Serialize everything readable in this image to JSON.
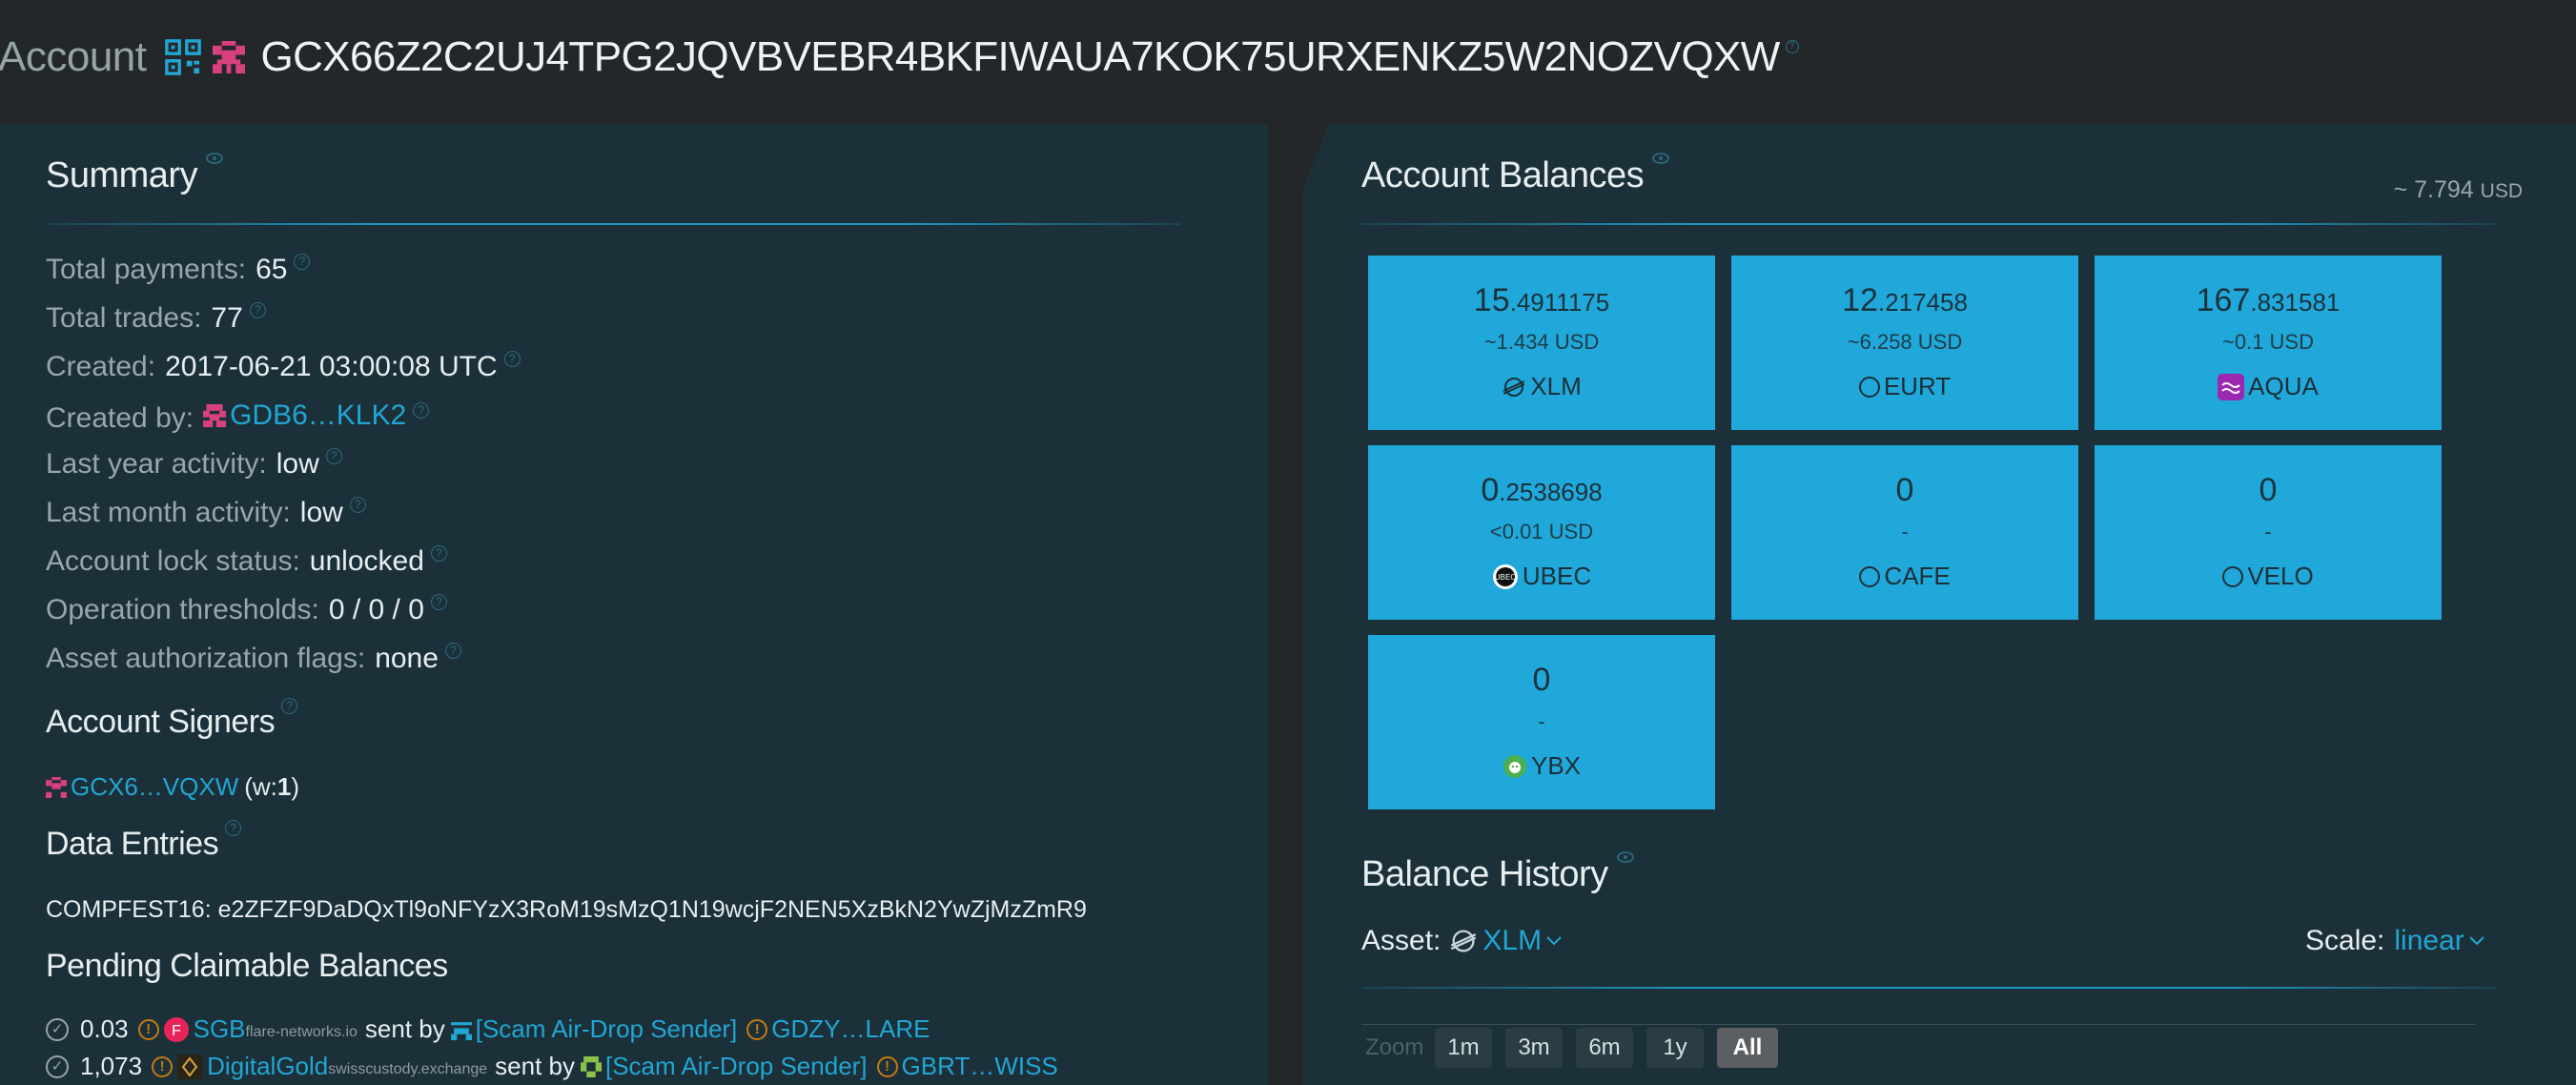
{
  "header": {
    "label": "Account",
    "address": "GCX66Z2C2UJ4TPG2JQVBVEBR4BKFIWAUA7KOK75URXENKZ5W2NOZVQXW"
  },
  "summary": {
    "title": "Summary",
    "rows": [
      {
        "key": "Total payments:",
        "value": "65"
      },
      {
        "key": "Total trades:",
        "value": "77"
      },
      {
        "key": "Created:",
        "value": "2017-06-21 03:00:08 UTC"
      },
      {
        "key": "Created by:",
        "value": "GDB6…KLK2"
      },
      {
        "key": "Last year activity:",
        "value": "low"
      },
      {
        "key": "Last month activity:",
        "value": "low"
      },
      {
        "key": "Account lock status:",
        "value": "unlocked"
      },
      {
        "key": "Operation thresholds:",
        "value": "0 / 0 / 0"
      },
      {
        "key": "Asset authorization flags:",
        "value": "none"
      }
    ]
  },
  "signers": {
    "title": "Account Signers",
    "address": "GCX6…VQXW",
    "weight_prefix": "(w:",
    "weight": "1",
    "weight_suffix": ")"
  },
  "data_entries": {
    "title": "Data Entries",
    "entry": "COMPFEST16: e2ZFZF9DaDQxTl9oNFYzX3RoM19sMzQ1N19wcjF2NEN5XzBkN2YwZjMzZmR9"
  },
  "claimable": {
    "title": "Pending Claimable Balances",
    "rows": [
      {
        "amount": "0.03",
        "asset": "SGB",
        "domain": "flare-networks.io",
        "sent_by": "sent by",
        "scam": "[Scam Air-Drop Sender]",
        "sender": "GDZY…LARE"
      },
      {
        "amount": "1,073",
        "asset": "DigitalGold",
        "domain": "swisscustody.exchange",
        "sent_by": "sent by",
        "scam": "[Scam Air-Drop Sender]",
        "sender": "GBRT…WISS"
      }
    ]
  },
  "balances": {
    "title": "Account Balances",
    "total_prefix": "~ 7.794",
    "total_unit": "USD",
    "tiles": [
      {
        "int": "15",
        "frac": ".4911175",
        "usd": "~1.434 USD",
        "asset": "XLM",
        "icon": "stellar-icon"
      },
      {
        "int": "12",
        "frac": ".217458",
        "usd": "~6.258 USD",
        "asset": "EURT",
        "icon": "ring-icon"
      },
      {
        "int": "167",
        "frac": ".831581",
        "usd": "~0.1 USD",
        "asset": "AQUA",
        "icon": "aqua-icon"
      },
      {
        "int": "0",
        "frac": ".2538698",
        "usd": "<0.01 USD",
        "asset": "UBEC",
        "icon": "ubec-icon"
      },
      {
        "int": "0",
        "frac": "",
        "usd": "-",
        "asset": "CAFE",
        "icon": "ring-icon"
      },
      {
        "int": "0",
        "frac": "",
        "usd": "-",
        "asset": "VELO",
        "icon": "ring-icon"
      },
      {
        "int": "0",
        "frac": "",
        "usd": "-",
        "asset": "YBX",
        "icon": "ybx-icon"
      }
    ]
  },
  "history": {
    "title": "Balance History",
    "asset_label": "Asset:",
    "asset_value": "XLM",
    "scale_label": "Scale:",
    "scale_value": "linear",
    "zoom_label": "Zoom",
    "zoom_buttons": [
      "1m",
      "3m",
      "6m",
      "1y",
      "All"
    ],
    "zoom_active": "All"
  },
  "colors": {
    "accent": "#21a6d3",
    "tile": "#21a8da",
    "panel": "#1c3039",
    "background": "#23272a",
    "warning": "#c47a12",
    "identicon": "#d8407e"
  }
}
